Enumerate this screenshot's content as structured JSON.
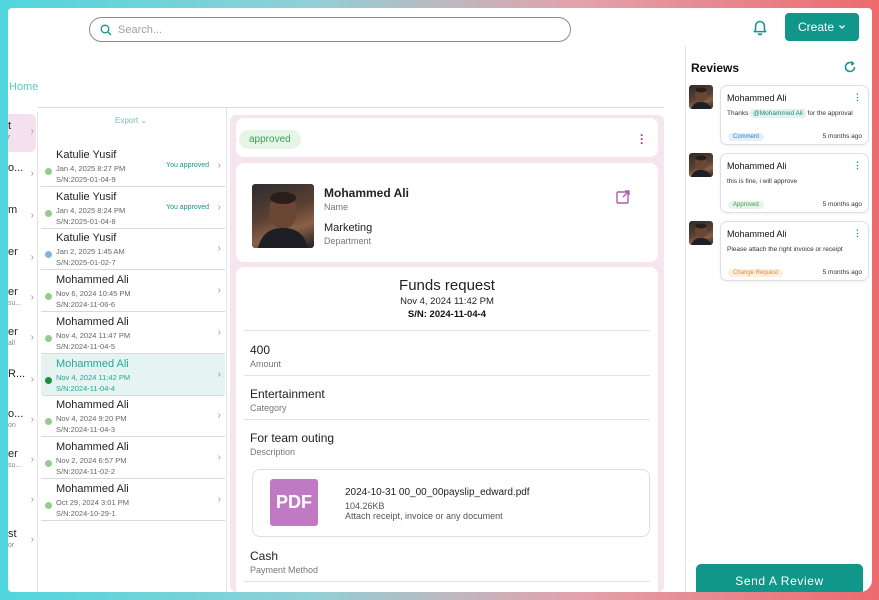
{
  "header": {
    "search_placeholder": "Search...",
    "create_label": "Create"
  },
  "breadcrumb": {
    "home": "Home"
  },
  "leftcol": {
    "items": [
      {
        "title": "t",
        "sub": "r",
        "active": true
      },
      {
        "title": "o...",
        "sub": ""
      },
      {
        "title": "m",
        "sub": ""
      },
      {
        "title": "er",
        "sub": ""
      },
      {
        "title": "er",
        "sub": "su..."
      },
      {
        "title": "er",
        "sub": "all"
      },
      {
        "title": "R...",
        "sub": ""
      },
      {
        "title": "o...",
        "sub": "on"
      },
      {
        "title": "er",
        "sub": "su..."
      },
      {
        "title": "",
        "sub": ""
      },
      {
        "title": "st",
        "sub": "or"
      }
    ]
  },
  "list": {
    "export_label": "Export",
    "items": [
      {
        "name": "Katulie Yusif",
        "date": "Jan 4, 2025 8:27 PM",
        "sn": "S/N:2025-01-04-9",
        "tag": "You approved",
        "dot": "#94cc8f"
      },
      {
        "name": "Katulie Yusif",
        "date": "Jan 4, 2025 8:24 PM",
        "sn": "S/N:2025-01-04-8",
        "tag": "You approved",
        "dot": "#94cc8f"
      },
      {
        "name": "Katulie Yusif",
        "date": "Jan 2, 2025 1:45 AM",
        "sn": "S/N:2025-01-02-7",
        "tag": "",
        "dot": "#7fb5e6"
      },
      {
        "name": "Mohammed Ali",
        "date": "Nov 6, 2024 10:45 PM",
        "sn": "S/N:2024-11-06-6",
        "tag": "",
        "dot": "#94cc8f"
      },
      {
        "name": "Mohammed Ali",
        "date": "Nov 4, 2024 11:47 PM",
        "sn": "S/N:2024-11-04-5",
        "tag": "",
        "dot": "#94cc8f"
      },
      {
        "name": "Mohammed Ali",
        "date": "Nov 4, 2024 11:42 PM",
        "sn": "S/N:2024-11-04-4",
        "tag": "",
        "dot": "#1a8f3d",
        "active": true
      },
      {
        "name": "Mohammed Ali",
        "date": "Nov 4, 2024 9:20 PM",
        "sn": "S/N:2024-11-04-3",
        "tag": "",
        "dot": "#94cc8f"
      },
      {
        "name": "Mohammed Ali",
        "date": "Nov 2, 2024 6:57 PM",
        "sn": "S/N:2024-11-02-2",
        "tag": "",
        "dot": "#94cc8f"
      },
      {
        "name": "Mohammed Ali",
        "date": "Oct 29, 2024 3:01 PM",
        "sn": "S/N:2024-10-29-1",
        "tag": "",
        "dot": "#94cc8f"
      }
    ]
  },
  "detail": {
    "status": "approved",
    "person": {
      "name": "Mohammed Ali",
      "name_label": "Name",
      "department": "Marketing",
      "department_label": "Department"
    },
    "request": {
      "title": "Funds request",
      "date": "Nov 4, 2024 11:42 PM",
      "sn": "S/N: 2024-11-04-4"
    },
    "fields": [
      {
        "value": "400",
        "label": "Amount"
      },
      {
        "value": "Entertainment",
        "label": "Category"
      },
      {
        "value": "For team outing",
        "label": "Description"
      }
    ],
    "file": {
      "badge": "PDF",
      "name": "2024-10-31 00_00_00payslip_edward.pdf",
      "size": "104.26KB",
      "hint": "Attach receipt, invoice or any document"
    },
    "payment": {
      "value": "Cash",
      "label": "Payment Method"
    }
  },
  "reviews": {
    "title": "Reviews",
    "items": [
      {
        "name": "Mohammed Ali",
        "pre": "Thanks",
        "mention": "@Mohammed Ali",
        "post": "for the approval",
        "badge": "Comment",
        "badge_color": "#2f7fc7",
        "badge_bg": "#e4f0fb",
        "ago": "5 months ago"
      },
      {
        "name": "Mohammed Ali",
        "pre": "this is fine, i will approve",
        "mention": "",
        "post": "",
        "badge": "Approved",
        "badge_color": "#3b9a55",
        "badge_bg": "#e6f5e8",
        "ago": "5 months ago"
      },
      {
        "name": "Mohammed Ali",
        "pre": "Please attach the right invoice or receipt",
        "mention": "",
        "post": "",
        "badge": "Change Request",
        "badge_color": "#e58a2c",
        "badge_bg": "#fdf0e2",
        "ago": "5 months ago"
      }
    ],
    "send_label": "Send A Review"
  },
  "colors": {
    "accent": "#11968a",
    "pink": "#f6e4ef",
    "pdf": "#c07ac4"
  }
}
